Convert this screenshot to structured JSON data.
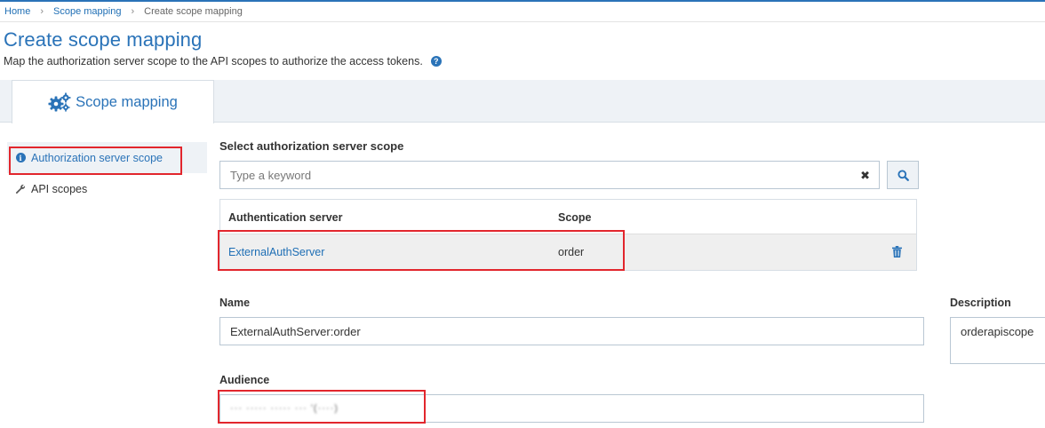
{
  "breadcrumb": {
    "home": "Home",
    "scope_mapping": "Scope mapping",
    "current": "Create scope mapping",
    "separator": "›"
  },
  "page": {
    "title": "Create scope mapping",
    "subtitle": "Map the authorization server scope to the API scopes to authorize the access tokens.",
    "help_icon": "?"
  },
  "tab": {
    "label": "Scope mapping",
    "icon": "gears-icon"
  },
  "side_nav": {
    "items": [
      {
        "label": "Authorization server scope",
        "icon": "info-icon",
        "active": true
      },
      {
        "label": "API scopes",
        "icon": "wrench-icon",
        "active": false
      }
    ]
  },
  "select_section": {
    "label": "Select authorization server scope",
    "search_placeholder": "Type a keyword",
    "clear_icon": "✖"
  },
  "table": {
    "headers": [
      "Authentication server",
      "Scope"
    ],
    "rows": [
      {
        "server": "ExternalAuthServer",
        "scope": "order"
      }
    ]
  },
  "form": {
    "name_label": "Name",
    "name_value": "ExternalAuthServer:order",
    "description_label": "Description",
    "description_value": "orderapiscope",
    "audience_label": "Audience",
    "audience_value": "··· ····· ····· ··· '(····)"
  },
  "colors": {
    "accent": "#2a73b8",
    "highlight": "#e2262d",
    "tab_strip": "#eef2f6",
    "row_bg": "#efefef"
  }
}
